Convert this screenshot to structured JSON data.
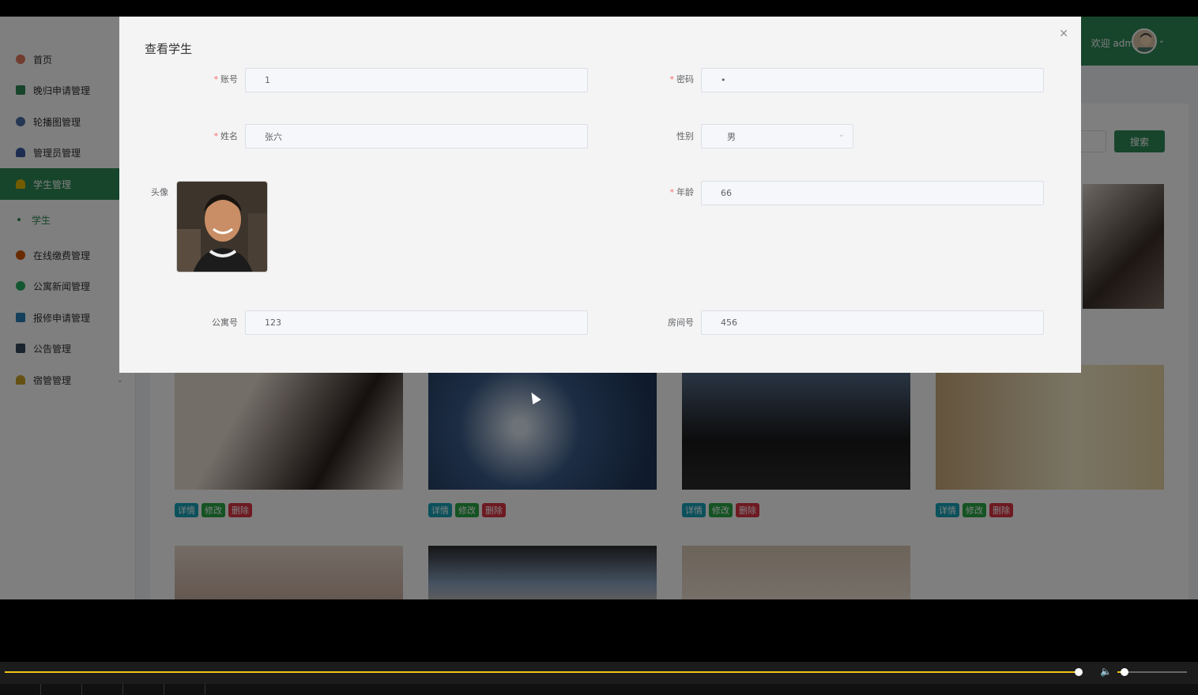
{
  "sidebar": {
    "items": [
      {
        "label": "首页",
        "color": "#e07a5f"
      },
      {
        "label": "晚归申请管理",
        "color": "#2e8b57"
      },
      {
        "label": "轮播图管理",
        "color": "#4a6fa5"
      },
      {
        "label": "管理员管理",
        "color": "#3b5ba5"
      },
      {
        "label": "学生管理",
        "color": "#e6b800"
      },
      {
        "label": "在线缴费管理",
        "color": "#d35400"
      },
      {
        "label": "公寓新闻管理",
        "color": "#27ae60"
      },
      {
        "label": "报修申请管理",
        "color": "#2980b9"
      },
      {
        "label": "公告管理",
        "color": "#34495e"
      },
      {
        "label": "宿管管理",
        "color": "#c9a227"
      }
    ],
    "sub_item": "学生"
  },
  "header": {
    "welcome": "欢迎 admin"
  },
  "main": {
    "search_button": "搜索",
    "card_buttons": {
      "detail": "详情",
      "edit": "修改",
      "delete": "删除"
    }
  },
  "dialog": {
    "title": "查看学生",
    "fields": {
      "account": {
        "label": "账号",
        "value": "1"
      },
      "password": {
        "label": "密码",
        "value": "•"
      },
      "name": {
        "label": "姓名",
        "value": "张六"
      },
      "gender": {
        "label": "性别",
        "value": "男"
      },
      "avatar": {
        "label": "头像"
      },
      "age": {
        "label": "年龄",
        "value": "66"
      },
      "apartment": {
        "label": "公寓号",
        "value": "123"
      },
      "room": {
        "label": "房间号",
        "value": "456"
      }
    }
  },
  "player": {
    "progress": 0.9,
    "volume": 0.1
  }
}
